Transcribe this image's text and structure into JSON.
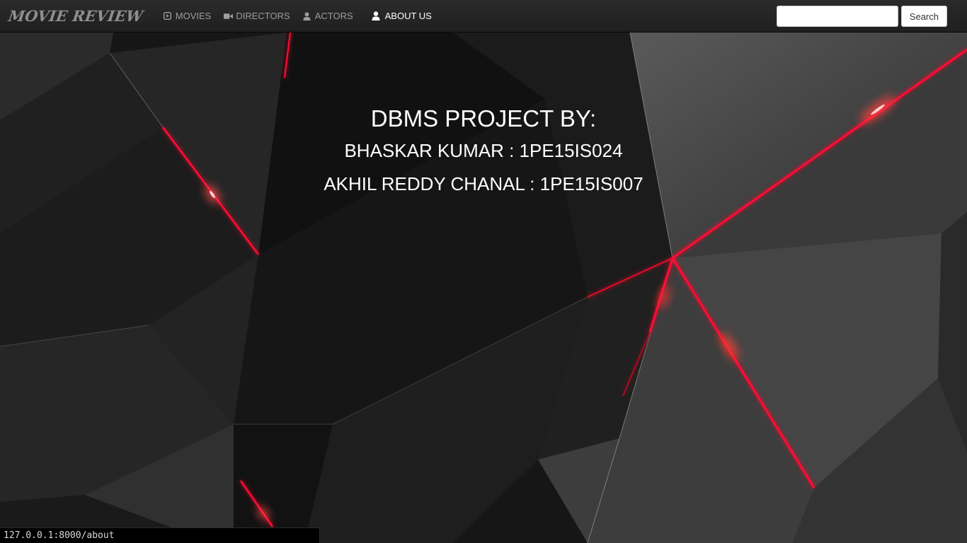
{
  "navbar": {
    "brand": "MOVIE REVIEW",
    "items": [
      {
        "label": "MOVIES",
        "icon": "play-icon"
      },
      {
        "label": "DIRECTORS",
        "icon": "video-camera-icon"
      },
      {
        "label": "ACTORS",
        "icon": "user-icon"
      },
      {
        "label": "ABOUT US",
        "icon": "user-icon",
        "active": true
      }
    ],
    "search": {
      "value": "",
      "placeholder": "",
      "button_label": "Search"
    }
  },
  "main": {
    "heading": "DBMS PROJECT BY:",
    "members": [
      "BHASKAR KUMAR : 1PE15IS024",
      "AKHIL REDDY CHANAL : 1PE15IS007"
    ]
  },
  "status_bar": {
    "url": "127.0.0.1:8000/about"
  },
  "colors": {
    "navbar_bg": "#222222",
    "nav_text": "#9d9d9d",
    "nav_active_text": "#ffffff",
    "background": "#141414",
    "accent_red": "#ff1030",
    "content_text": "#ffffff"
  }
}
